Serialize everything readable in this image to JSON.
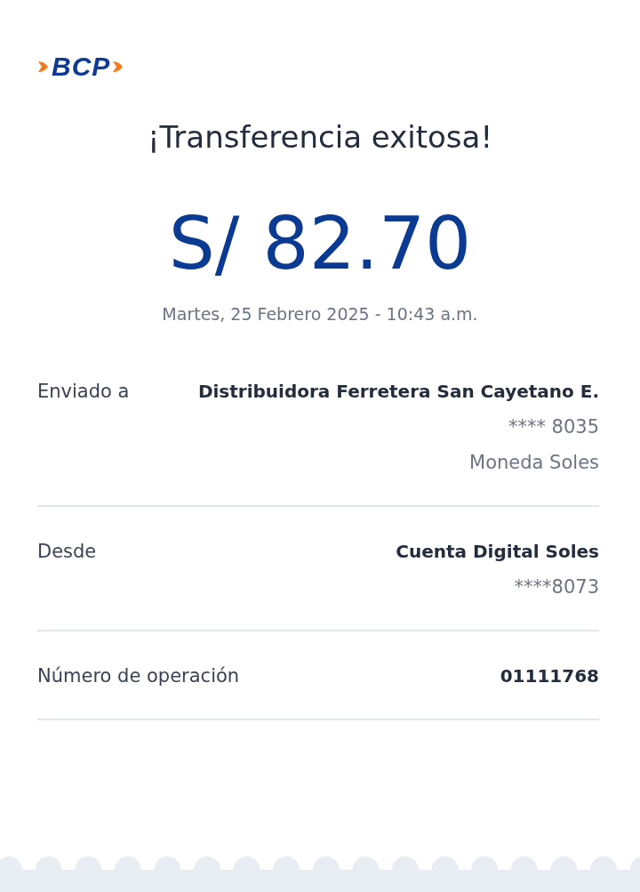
{
  "logo": {
    "text": "BCP"
  },
  "title": "¡Transferencia exitosa!",
  "amount": "S/ 82.70",
  "date": "Martes, 25 Febrero 2025 - 10:43 a.m.",
  "details": [
    {
      "label": "Enviado a",
      "values": [
        {
          "text": "Distribuidora Ferretera San Cayetano E.",
          "kind": "bold"
        },
        {
          "text": "**** 8035",
          "kind": "plain"
        },
        {
          "text": "Moneda Soles",
          "kind": "plain"
        }
      ]
    },
    {
      "label": "Desde",
      "values": [
        {
          "text": "Cuenta Digital Soles",
          "kind": "bold"
        },
        {
          "text": "****8073",
          "kind": "plain"
        }
      ]
    },
    {
      "label": "Número de operación",
      "values": [
        {
          "text": "01111768",
          "kind": "bold"
        }
      ]
    }
  ]
}
